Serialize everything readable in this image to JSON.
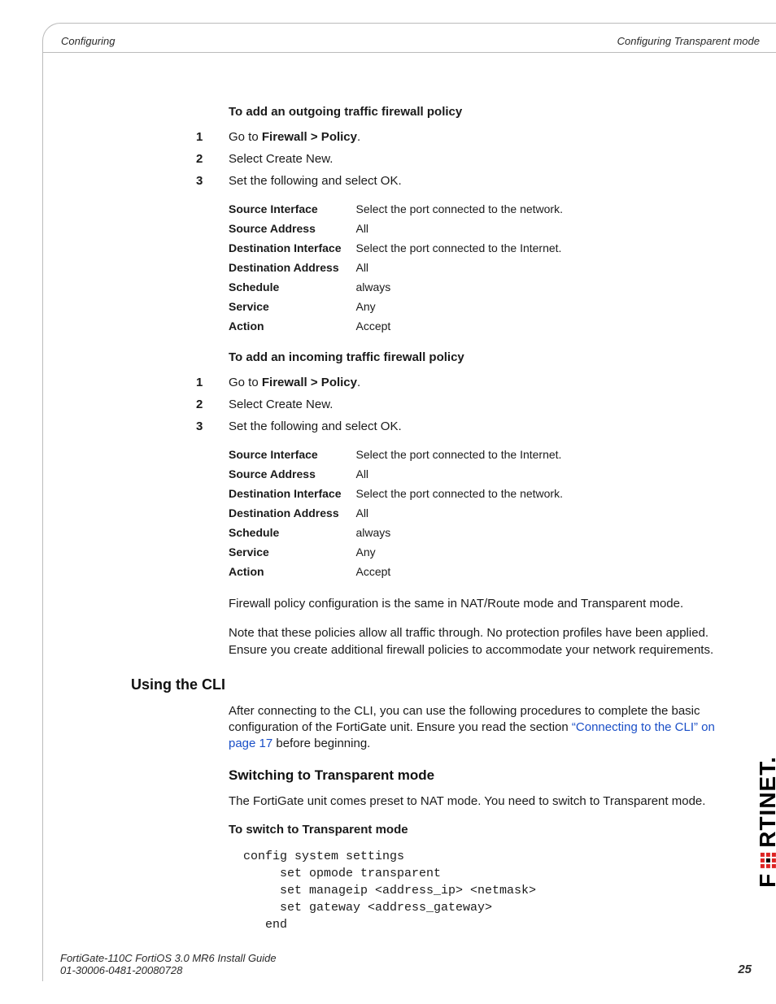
{
  "header": {
    "left": "Configuring",
    "right": "Configuring Transparent mode"
  },
  "outgoing": {
    "title": "To add an outgoing traffic firewall policy",
    "steps": {
      "s1pre": "Go to ",
      "s1b": "Firewall > Policy",
      "s1post": ".",
      "s2": "Select Create New.",
      "s3": "Set the following and select OK."
    },
    "table": [
      {
        "label": "Source Interface",
        "value": "Select the port connected to the network."
      },
      {
        "label": "Source Address",
        "value": "All"
      },
      {
        "label": "Destination Interface",
        "value": "Select the port connected to the Internet."
      },
      {
        "label": "Destination Address",
        "value": "All"
      },
      {
        "label": "Schedule",
        "value": "always"
      },
      {
        "label": "Service",
        "value": "Any"
      },
      {
        "label": "Action",
        "value": "Accept"
      }
    ]
  },
  "incoming": {
    "title": "To add an incoming traffic firewall policy",
    "steps": {
      "s1pre": "Go to ",
      "s1b": "Firewall > Policy",
      "s1post": ".",
      "s2": "Select Create New.",
      "s3": "Set the following and select OK."
    },
    "table": [
      {
        "label": "Source Interface",
        "value": "Select the port connected to the Internet."
      },
      {
        "label": "Source Address",
        "value": "All"
      },
      {
        "label": "Destination Interface",
        "value": "Select the port connected to the network."
      },
      {
        "label": "Destination Address",
        "value": "All"
      },
      {
        "label": "Schedule",
        "value": "always"
      },
      {
        "label": "Service",
        "value": "Any"
      },
      {
        "label": "Action",
        "value": "Accept"
      }
    ],
    "para1": "Firewall policy configuration is the same in NAT/Route mode and Transparent mode.",
    "para2": "Note that these policies allow all traffic through. No protection profiles have been applied. Ensure you create additional firewall policies to accommodate your network requirements."
  },
  "cli": {
    "heading": "Using the CLI",
    "para_pre": "After connecting to the CLI, you can use the following procedures to complete the basic configuration of the FortiGate unit. Ensure you read the section ",
    "para_link": "“Connecting to the CLI” on page 17",
    "para_post": " before beginning."
  },
  "switch": {
    "heading": "Switching to Transparent mode",
    "para": "The FortiGate unit comes preset to NAT mode. You need to switch to Transparent mode.",
    "subheading": "To switch to Transparent mode",
    "code": "config system settings\n     set opmode transparent\n     set manageip <address_ip> <netmask>\n     set gateway <address_gateway>\n   end"
  },
  "footer": {
    "line1": "FortiGate-110C FortiOS 3.0 MR6 Install Guide",
    "line2": "01-30006-0481-20080728",
    "page": "25"
  },
  "brand": "F    RTINET"
}
